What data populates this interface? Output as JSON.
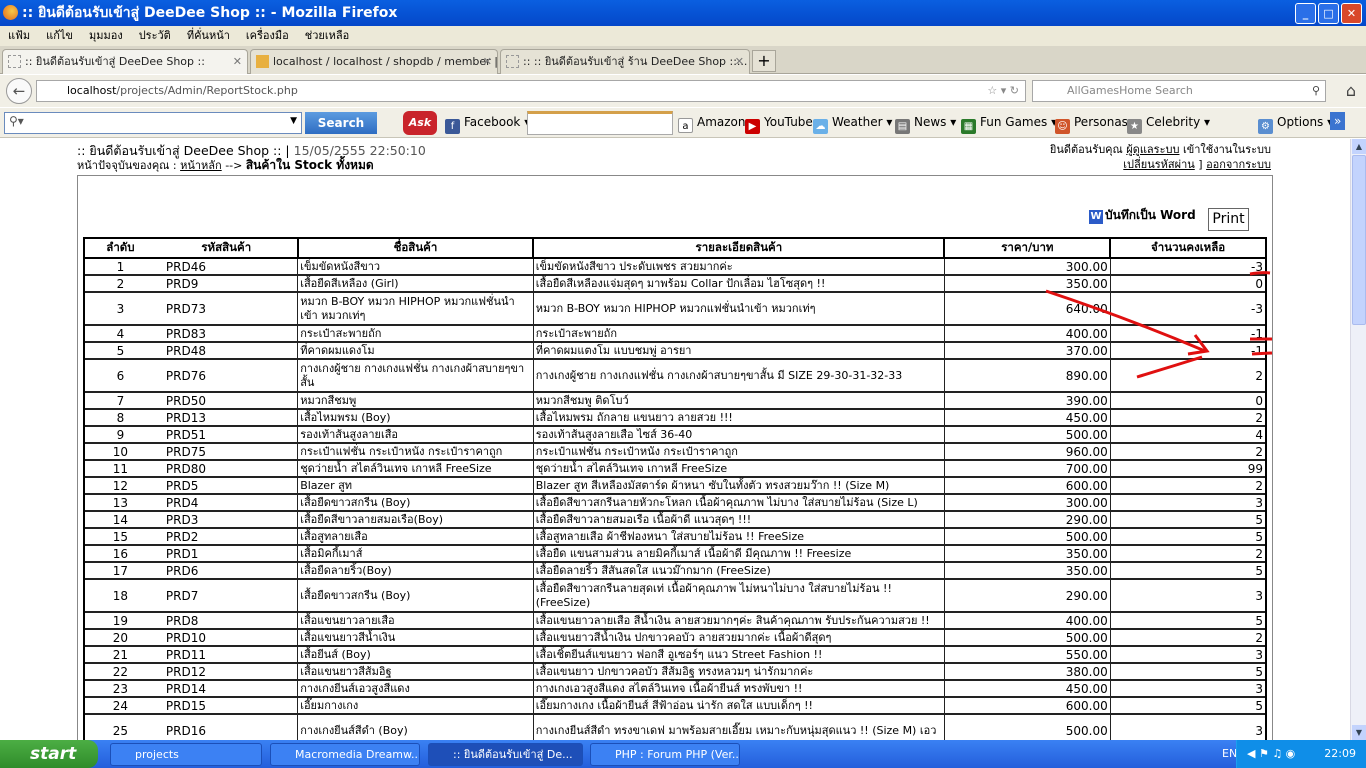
{
  "window": {
    "title": ":: ยินดีต้อนรับเข้าสู่ DeeDee Shop :: - Mozilla Firefox"
  },
  "menu": [
    "แฟ้ม",
    "แก้ไข",
    "มุมมอง",
    "ประวัติ",
    "ที่คั่นหน้า",
    "เครื่องมือ",
    "ช่วยเหลือ"
  ],
  "tabs": [
    ":: ยินดีต้อนรับเข้าสู่ DeeDee Shop ::",
    "localhost / localhost / shopdb / member | ...",
    ":: :: ยินดีต้อนรับเข้าสู่ ร้าน DeeDee Shop ::..."
  ],
  "url": {
    "host": "localhost",
    "path": "/projects/Admin/ReportStock.php"
  },
  "search_placeholder": "AllGamesHome Search",
  "toolbar": {
    "search": "Search",
    "ask": "Ask",
    "facebook": "Facebook",
    "amazon": "Amazon",
    "youtube": "YouTube",
    "weather": "Weather",
    "news": "News",
    "fungames": "Fun Games",
    "personas": "Personas",
    "celebrity": "Celebrity",
    "options": "Options"
  },
  "page": {
    "welcome": ":: ยินดีต้อนรับเข้าสู่ DeeDee Shop :: |",
    "datetime": "15/05/2555 22:50:10",
    "crumb_label": "หน้าปัจจุบันของคุณ :",
    "crumb_home": "หน้าหลัก",
    "crumb_sep": "-->",
    "crumb_current": "สินค้าใน Stock ทั้งหมด",
    "user_greet": "ยินดีต้อนรับคุณ",
    "user_name": "ผู้ดูแลระบบ",
    "user_suffix": "เข้าใช้งานในระบบ",
    "change_pw": "เปลี่ยนรหัสผ่าน",
    "bracket": "]",
    "logout": "ออกจากระบบ",
    "save_word": "บันทึกเป็น Word",
    "print": "Print"
  },
  "table": {
    "headers": [
      "ลำดับ",
      "รหัสสินค้า",
      "ชื่อสินค้า",
      "รายละเอียดสินค้า",
      "ราคา/บาท",
      "จำนวนคงเหลือ"
    ],
    "rows": [
      [
        "1",
        "PRD46",
        "เข็มขัดหนังสีขาว",
        "เข็มขัดหนังสีขาว ประดับเพชร สวยมากค่ะ",
        "300.00",
        "-3"
      ],
      [
        "2",
        "PRD9",
        "เสื้อยืดสีเหลือง (Girl)",
        "เสื้อยืดสีเหลืองแจ่มสุดๆ มาพร้อม Collar ปักเลื่อม ไฮโซสุดๆ !!",
        "350.00",
        "0"
      ],
      [
        "3",
        "PRD73",
        "หมวก B-BOY หมวก HIPHOP หมวกแฟชั่นนำเข้า หมวกเท่ๆ",
        "หมวก B-BOY หมวก HIPHOP หมวกแฟชั่นนำเข้า หมวกเท่ๆ",
        "640.00",
        "-3"
      ],
      [
        "4",
        "PRD83",
        "กระเป๋าสะพายถัก",
        "กระเป๋าสะพายถัก",
        "400.00",
        "-1"
      ],
      [
        "5",
        "PRD48",
        "ที่คาดผมแดงโม",
        "ที่คาดผมแตงโม แบบชมพู่ อารยา",
        "370.00",
        "-1"
      ],
      [
        "6",
        "PRD76",
        "กางเกงผู้ชาย กางเกงแฟชั่น กางเกงผ้าสบายๆขาสั้น",
        "กางเกงผู้ชาย กางเกงแฟชั่น กางเกงผ้าสบายๆขาสั้น มี SIZE 29-30-31-32-33",
        "890.00",
        "2"
      ],
      [
        "7",
        "PRD50",
        "หมวกสีชมพู",
        "หมวกสีชมพู ติดโบว์",
        "390.00",
        "0"
      ],
      [
        "8",
        "PRD13",
        "เสื้อไหมพรม (Boy)",
        "เสื้อไหมพรม ถักลาย แขนยาว ลายสวย !!!",
        "450.00",
        "2"
      ],
      [
        "9",
        "PRD51",
        "รองเท้าส้นสูงลายเสือ",
        "รองเท้าส้นสูงลายเสือ ไซส์ 36-40",
        "500.00",
        "4"
      ],
      [
        "10",
        "PRD75",
        "กระเป๋าแฟชั่น กระเป๋าหนัง กระเป๋าราคาถูก",
        "กระเป๋าแฟชั่น กระเป๋าหนัง กระเป๋าราคาถูก",
        "960.00",
        "2"
      ],
      [
        "11",
        "PRD80",
        "ชุดว่ายน้ำ สไตล์วินเทจ เกาหลี FreeSize",
        "ชุดว่ายน้ำ สไตล์วินเทจ เกาหลี FreeSize",
        "700.00",
        "99"
      ],
      [
        "12",
        "PRD5",
        "Blazer สูท",
        "Blazer สูท สีเหลืองมัสตาร์ด ผ้าหนา ซับในทั้งตัว ทรงสวยมว๊าก !! (Size M)",
        "600.00",
        "2"
      ],
      [
        "13",
        "PRD4",
        "เสื้อยืดขาวสกรีน (Boy)",
        "เสื้อยืดสีขาวสกรีนลายหัวกะโหลก เนื้อผ้าคุณภาพ ไม่บาง ใส่สบายไม่ร้อน (Size L)",
        "300.00",
        "3"
      ],
      [
        "14",
        "PRD3",
        "เสื้อยืดสีขาวลายสมอเรือ(Boy)",
        "เสื้อยืดสีขาวลายสมอเรือ เนื้อผ้าดี แนวสุดๆ !!!",
        "290.00",
        "5"
      ],
      [
        "15",
        "PRD2",
        "เสื้อสูทลายเสือ",
        "เสื้อสูทลายเสือ ผ้าชีฟองหนา ใส่สบายไม่ร้อน !! FreeSize",
        "500.00",
        "5"
      ],
      [
        "16",
        "PRD1",
        "เสื้อมิคกี้เมาส์",
        "เสื้อยืด แขนสามส่วน ลายมิคกี้เมาส์ เนื้อผ้าดี มีคุณภาพ !! Freesize",
        "350.00",
        "2"
      ],
      [
        "17",
        "PRD6",
        "เสื้อยืดลายริ้ว(Boy)",
        "เสื้อยืดลายริ้ว สีสันสดใส แนวม๊ากมาก (FreeSize)",
        "350.00",
        "5"
      ],
      [
        "18",
        "PRD7",
        "เสื้อยืดขาวสกรีน (Boy)",
        "เสื้อยืดสีขาวสกรีนลายสุดเท่ เนื้อผ้าคุณภาพ ไม่หนาไม่บาง ใส่สบายไม่ร้อน !! (FreeSize)",
        "290.00",
        "3"
      ],
      [
        "19",
        "PRD8",
        "เสื้อแขนยาวลายเสือ",
        "เสื้อแขนยาวลายเสือ สีน้ำเงิน ลายสวยมากๆค่ะ สินค้าคุณภาพ รับประกันความสวย !!",
        "400.00",
        "5"
      ],
      [
        "20",
        "PRD10",
        "เสื้อแขนยาวสีน้ำเงิน",
        "เสื้อแขนยาวสีน้ำเงิน ปกขาวคอบัว ลายสวยมากค่ะ เนื้อผ้าดีสุดๆ",
        "500.00",
        "2"
      ],
      [
        "21",
        "PRD11",
        "เสื้อยีนส์ (Boy)",
        "เสื้อเชิ้ตยีนส์แขนยาว ฟอกสี อูเซอร์ๆ แนว Street Fashion !!",
        "550.00",
        "3"
      ],
      [
        "22",
        "PRD12",
        "เสื้อแขนยาวสีส้มอิฐ",
        "เสื้อแขนยาว ปกขาวคอบัว สีส้มอิฐ ทรงหลวมๆ น่ารักมากค่ะ",
        "380.00",
        "5"
      ],
      [
        "23",
        "PRD14",
        "กางเกงยีนส์เอวสูงสีแดง",
        "กางเกงเอวสูงสีแดง สไตล์วินเทจ เนื้อผ้ายีนส์ ทรงพับขา !!",
        "450.00",
        "3"
      ],
      [
        "24",
        "PRD15",
        "เอี๊ยมกางเกง",
        "เอี๊ยมกางเกง เนื้อผ้ายีนส์ สีฟ้าอ่อน น่ารัก สดใส แบบเด็กๆ !!",
        "600.00",
        "5"
      ],
      [
        "25",
        "PRD16",
        "กางเกงยีนส์สีดำ (Boy)",
        "กางเกงยีนส์สีดำ ทรงขาเดฟ มาพร้อมสายเอี๊ยม เหมาะกับหนุ่มสุดแนว !! (Size M) เอว",
        "500.00",
        "3"
      ]
    ],
    "tall_rows": [
      3,
      6,
      18,
      25
    ]
  },
  "taskbar": {
    "start": "start",
    "items": [
      "projects",
      "Macromedia Dreamw...",
      ":: ยินดีต้อนรับเข้าสู่ De...",
      "PHP : Forum PHP (Ver..."
    ],
    "lang": "EN",
    "clock": "22:09"
  },
  "colors": {
    "annotation": "#e01010",
    "titlebar": "#0a5fe0"
  }
}
